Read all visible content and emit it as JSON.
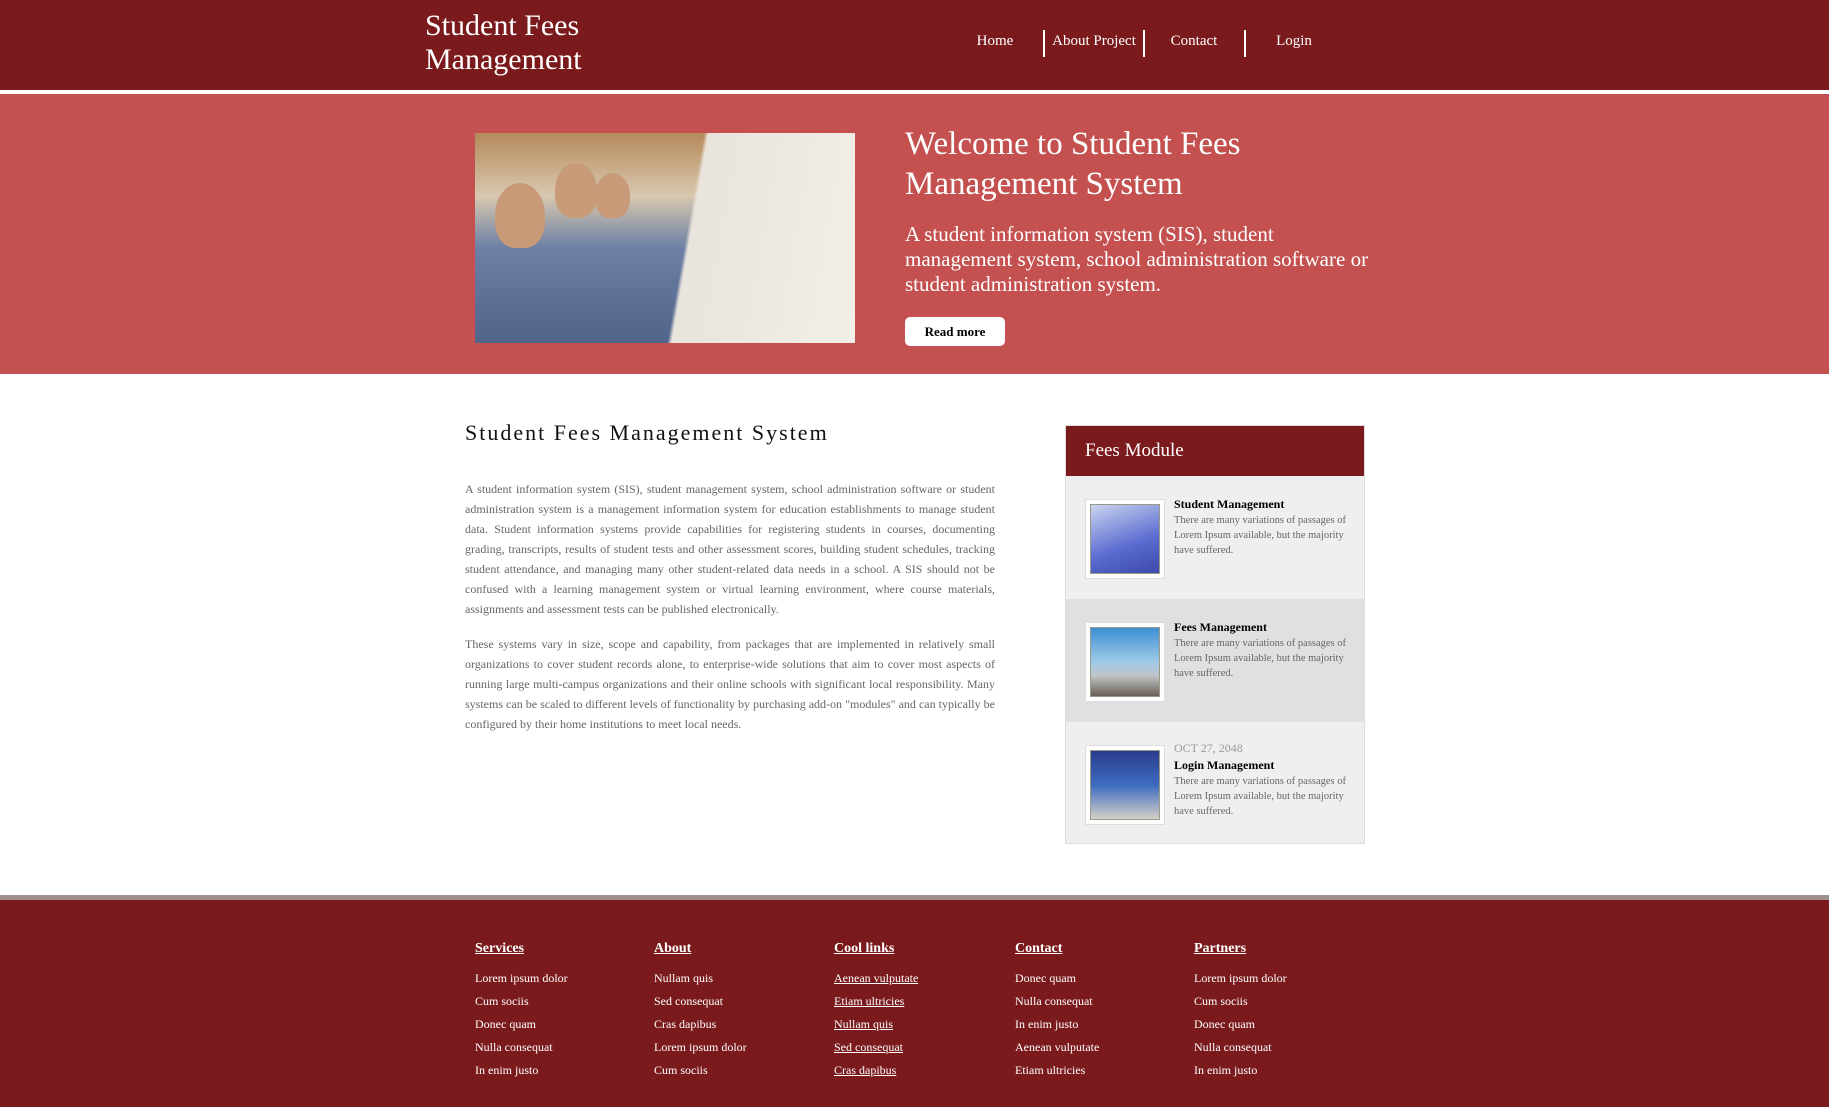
{
  "header": {
    "title": "Student Fees Management",
    "nav": [
      "Home",
      "About Project",
      "Contact",
      "Login"
    ]
  },
  "hero": {
    "title": "Welcome to Student Fees Management System",
    "text": "A student information system (SIS), student management system, school administration software or student administration system.",
    "button": "Read more"
  },
  "main": {
    "title": "Student Fees Management System",
    "paragraphs": [
      "A student information system (SIS), student management system, school administration software or student administration system is a management information system for education establishments to manage student data. Student information systems provide capabilities for registering students in courses, documenting grading, transcripts, results of student tests and other assessment scores, building student schedules, tracking student attendance, and managing many other student-related data needs in a school. A SIS should not be confused with a learning management system or virtual learning environment, where course materials, assignments and assessment tests can be published electronically.",
      "These systems vary in size, scope and capability, from packages that are implemented in relatively small organizations to cover student records alone, to enterprise-wide solutions that aim to cover most aspects of running large multi-campus organizations and their online schools with significant local responsibility. Many systems can be scaled to different levels of functionality by purchasing add-on \"modules\" and can typically be configured by their home institutions to meet local needs."
    ]
  },
  "sidebar": {
    "title": "Fees Module",
    "items": [
      {
        "title": "Student Management",
        "text": "There are many variations of passages of Lorem Ipsum available, but the majority have suffered."
      },
      {
        "title": "Fees Management",
        "text": "There are many variations of passages of Lorem Ipsum available, but the majority have suffered."
      },
      {
        "date": "OCT 27, 2048",
        "title": "Login Management",
        "text": "There are many variations of passages of Lorem Ipsum available, but the majority have suffered."
      }
    ]
  },
  "footer": {
    "columns": [
      {
        "title": "Services",
        "items": [
          "Lorem ipsum dolor",
          "Cum sociis",
          "Donec quam",
          "Nulla consequat",
          "In enim justo"
        ]
      },
      {
        "title": "About",
        "items": [
          "Nullam quis",
          "Sed consequat",
          "Cras dapibus",
          "Lorem ipsum dolor",
          "Cum sociis"
        ]
      },
      {
        "title": "Cool links",
        "items": [
          "Aenean vulputate",
          "Etiam ultricies",
          "Nullam quis",
          "Sed consequat",
          "Cras dapibus"
        ]
      },
      {
        "title": "Contact",
        "items": [
          "Donec quam",
          "Nulla consequat",
          "In enim justo",
          "Aenean vulputate",
          "Etiam ultricies"
        ]
      },
      {
        "title": "Partners",
        "items": [
          "Lorem ipsum dolor",
          "Cum sociis",
          "Donec quam",
          "Nulla consequat",
          "In enim justo"
        ]
      }
    ]
  },
  "colors": {
    "primary": "#7a1a1c",
    "hero": "#c45050"
  }
}
